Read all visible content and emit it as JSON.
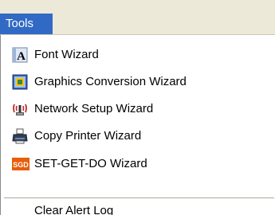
{
  "menu": {
    "title": "Tools",
    "items": [
      {
        "label": "Font Wizard",
        "icon": "font-wizard-icon"
      },
      {
        "label": "Graphics Conversion Wizard",
        "icon": "graphics-conversion-icon"
      },
      {
        "label": "Network Setup Wizard",
        "icon": "network-setup-icon"
      },
      {
        "label": "Copy Printer Wizard",
        "icon": "copy-printer-icon"
      },
      {
        "label": "SET-GET-DO Wizard",
        "icon": "sgd-icon",
        "icon_text": "SGD"
      },
      {
        "label": "Clear Alert Log"
      }
    ]
  },
  "colors": {
    "menu_highlight": "#316ac5",
    "menubar": "#ece9d8",
    "sgd_icon": "#e85d0a"
  }
}
